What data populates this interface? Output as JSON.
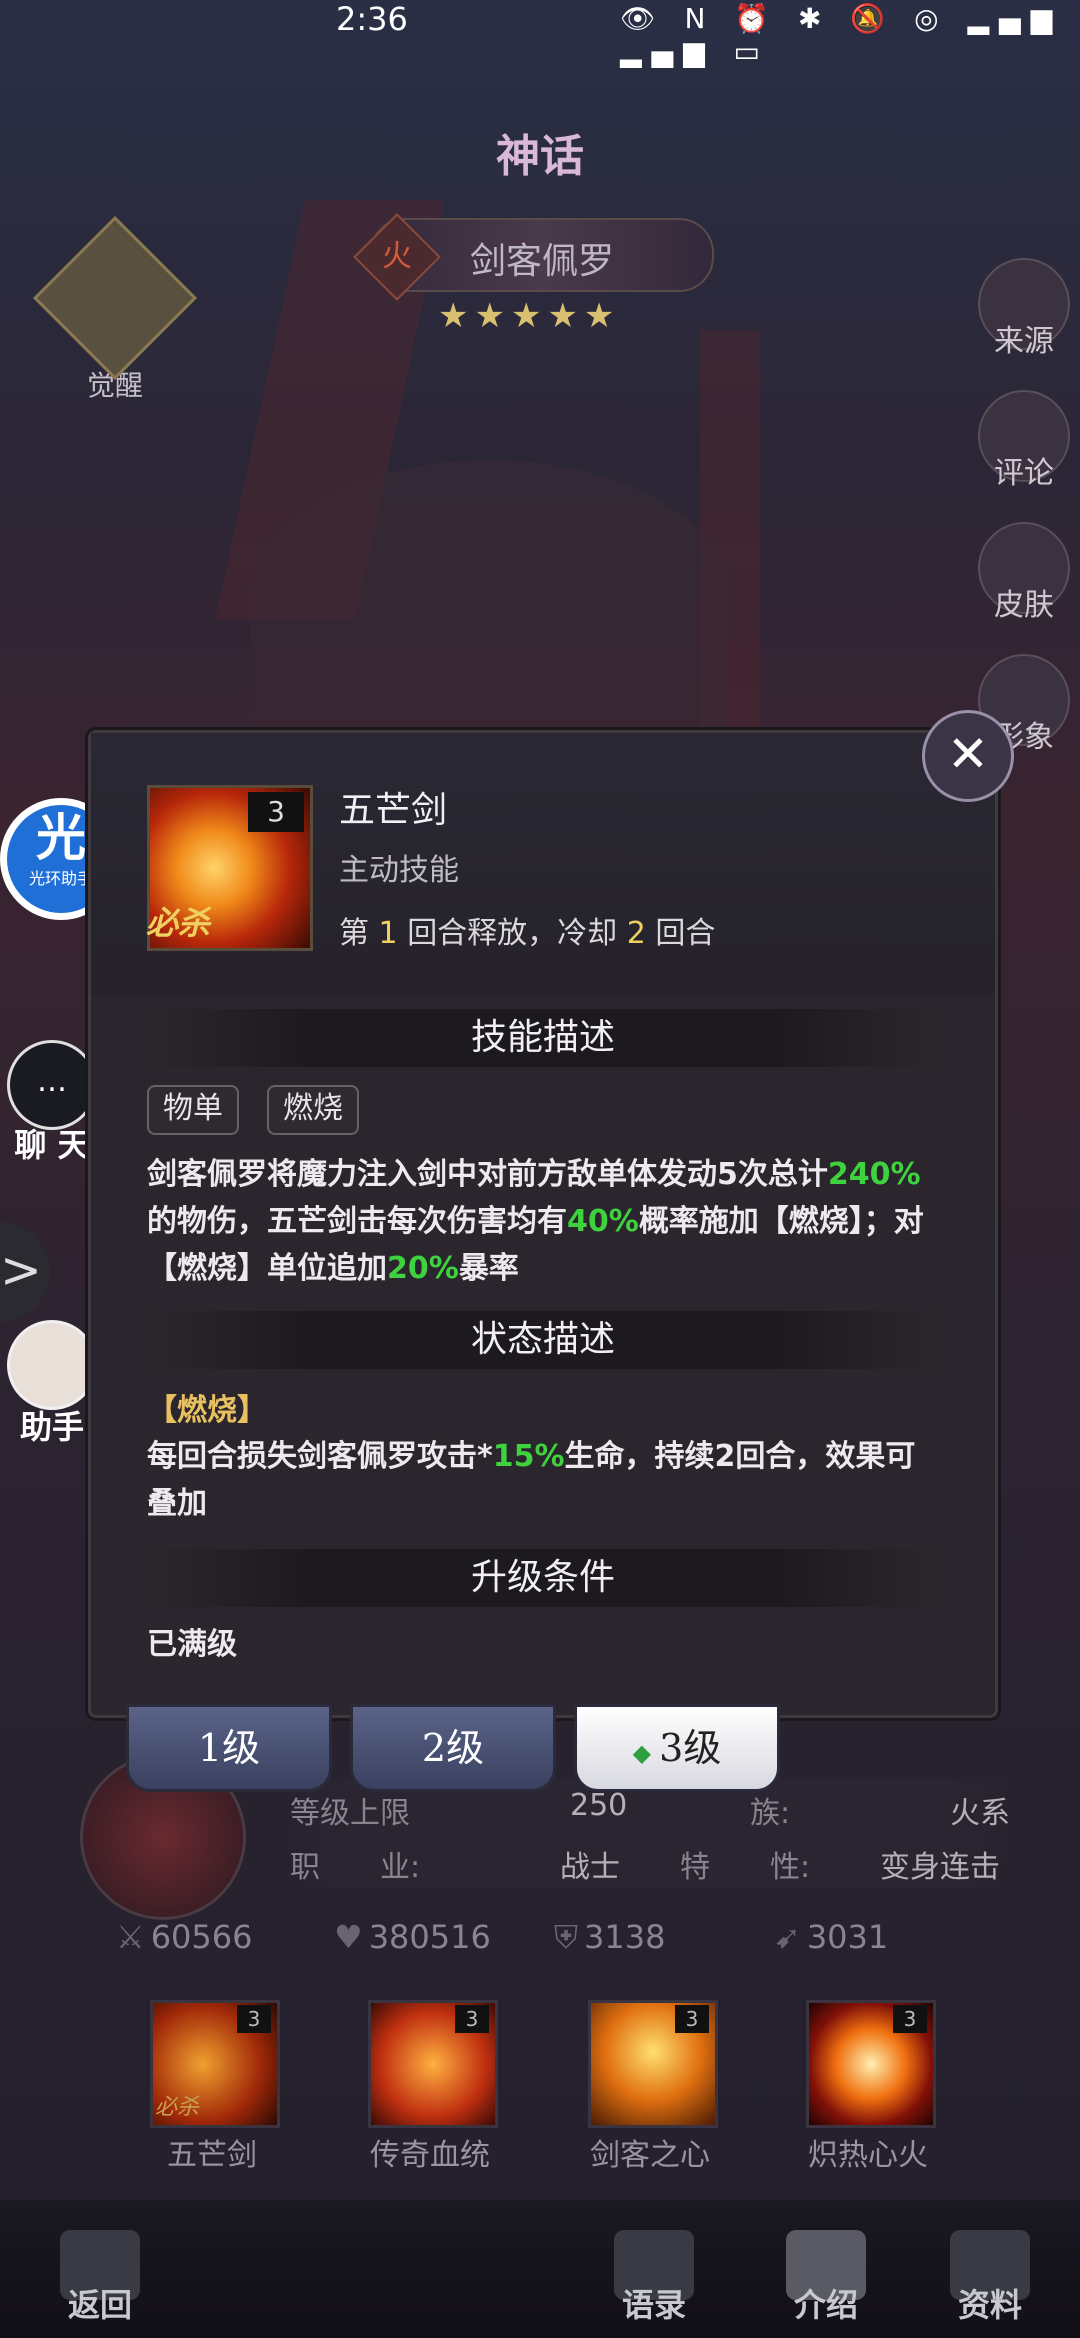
{
  "status_bar": {
    "time": "2:36",
    "icons": [
      "eye-icon",
      "nfc-icon",
      "alarm-icon",
      "bluetooth-icon",
      "mute-icon",
      "hotspot-icon",
      "signal-icon",
      "signal-icon",
      "battery-icon"
    ]
  },
  "header": {
    "title_badge": "神话",
    "hero_name": "剑客佩罗",
    "element_symbol": "火",
    "stars": "★★★★★",
    "awaken_label": "觉醒"
  },
  "side_buttons": [
    {
      "label": "来源",
      "icon": "source-icon"
    },
    {
      "label": "评论",
      "icon": "comment-icon"
    },
    {
      "label": "皮肤",
      "icon": "skin-icon"
    },
    {
      "label": "形象",
      "icon": "appearance-icon"
    }
  ],
  "overlay": {
    "assistant_logo_big": "光",
    "assistant_logo_small": "光环助手",
    "chat_label": "聊 天",
    "chat_icon": "…",
    "expand_icon": ">",
    "helper_label": "助手"
  },
  "skill_panel": {
    "icon_level": "3",
    "icon_badge": "必杀",
    "name": "五芒剑",
    "type": "主动技能",
    "cd_prefix": "第",
    "cd_round": "1",
    "cd_mid": "回合释放，冷却",
    "cd_cooldown": "2",
    "cd_suffix": "回合",
    "section_desc": "技能描述",
    "tags": [
      "物单",
      "燃烧"
    ],
    "desc_part1": "剑客佩罗将魔力注入剑中对前方敌单体发动5次总计",
    "desc_hl1": "240%",
    "desc_part2": "的物伤，五芒剑击每次伤害均有",
    "desc_hl2": "40%",
    "desc_part3": "概率施加【燃烧】；对【燃烧】单位追加",
    "desc_hl3": "20%",
    "desc_part4": "暴率",
    "section_status": "状态描述",
    "status_tag": "【燃烧】",
    "status_part1": "每回合损失剑客佩罗攻击*",
    "status_hl": "15%",
    "status_part2": "生命，持续2回合，效果可叠加",
    "section_upgrade": "升级条件",
    "upgrade_text": "已满级",
    "close_icon": "✕"
  },
  "level_tabs": [
    {
      "label": "1级",
      "active": false
    },
    {
      "label": "2级",
      "active": false
    },
    {
      "label": "3级",
      "active": true
    }
  ],
  "hero_info": {
    "row1_label": "等级上限",
    "row1_value": "250",
    "row1_label2": "族:",
    "row1_value2": "火系",
    "row2_label": "职　　业:",
    "row2_value": "战士",
    "row2_label2": "特　　性:",
    "row2_value2": "变身连击"
  },
  "stats": [
    {
      "icon": "attack-icon",
      "value": "60566"
    },
    {
      "icon": "heart-icon",
      "value": "380516"
    },
    {
      "icon": "shield-icon",
      "value": "3138"
    },
    {
      "icon": "speed-icon",
      "value": "3031"
    }
  ],
  "skills": [
    {
      "name": "五芒剑",
      "level": "3",
      "badge": "必杀"
    },
    {
      "name": "传奇血统",
      "level": "3",
      "badge": ""
    },
    {
      "name": "剑客之心",
      "level": "3",
      "badge": ""
    },
    {
      "name": "炽热心火",
      "level": "3",
      "badge": ""
    }
  ],
  "bottom_nav": [
    {
      "label": "返回",
      "icon": "back-icon"
    },
    {
      "label": "语录",
      "icon": "quotes-icon"
    },
    {
      "label": "介绍",
      "icon": "intro-icon"
    },
    {
      "label": "资料",
      "icon": "profile-icon"
    }
  ]
}
